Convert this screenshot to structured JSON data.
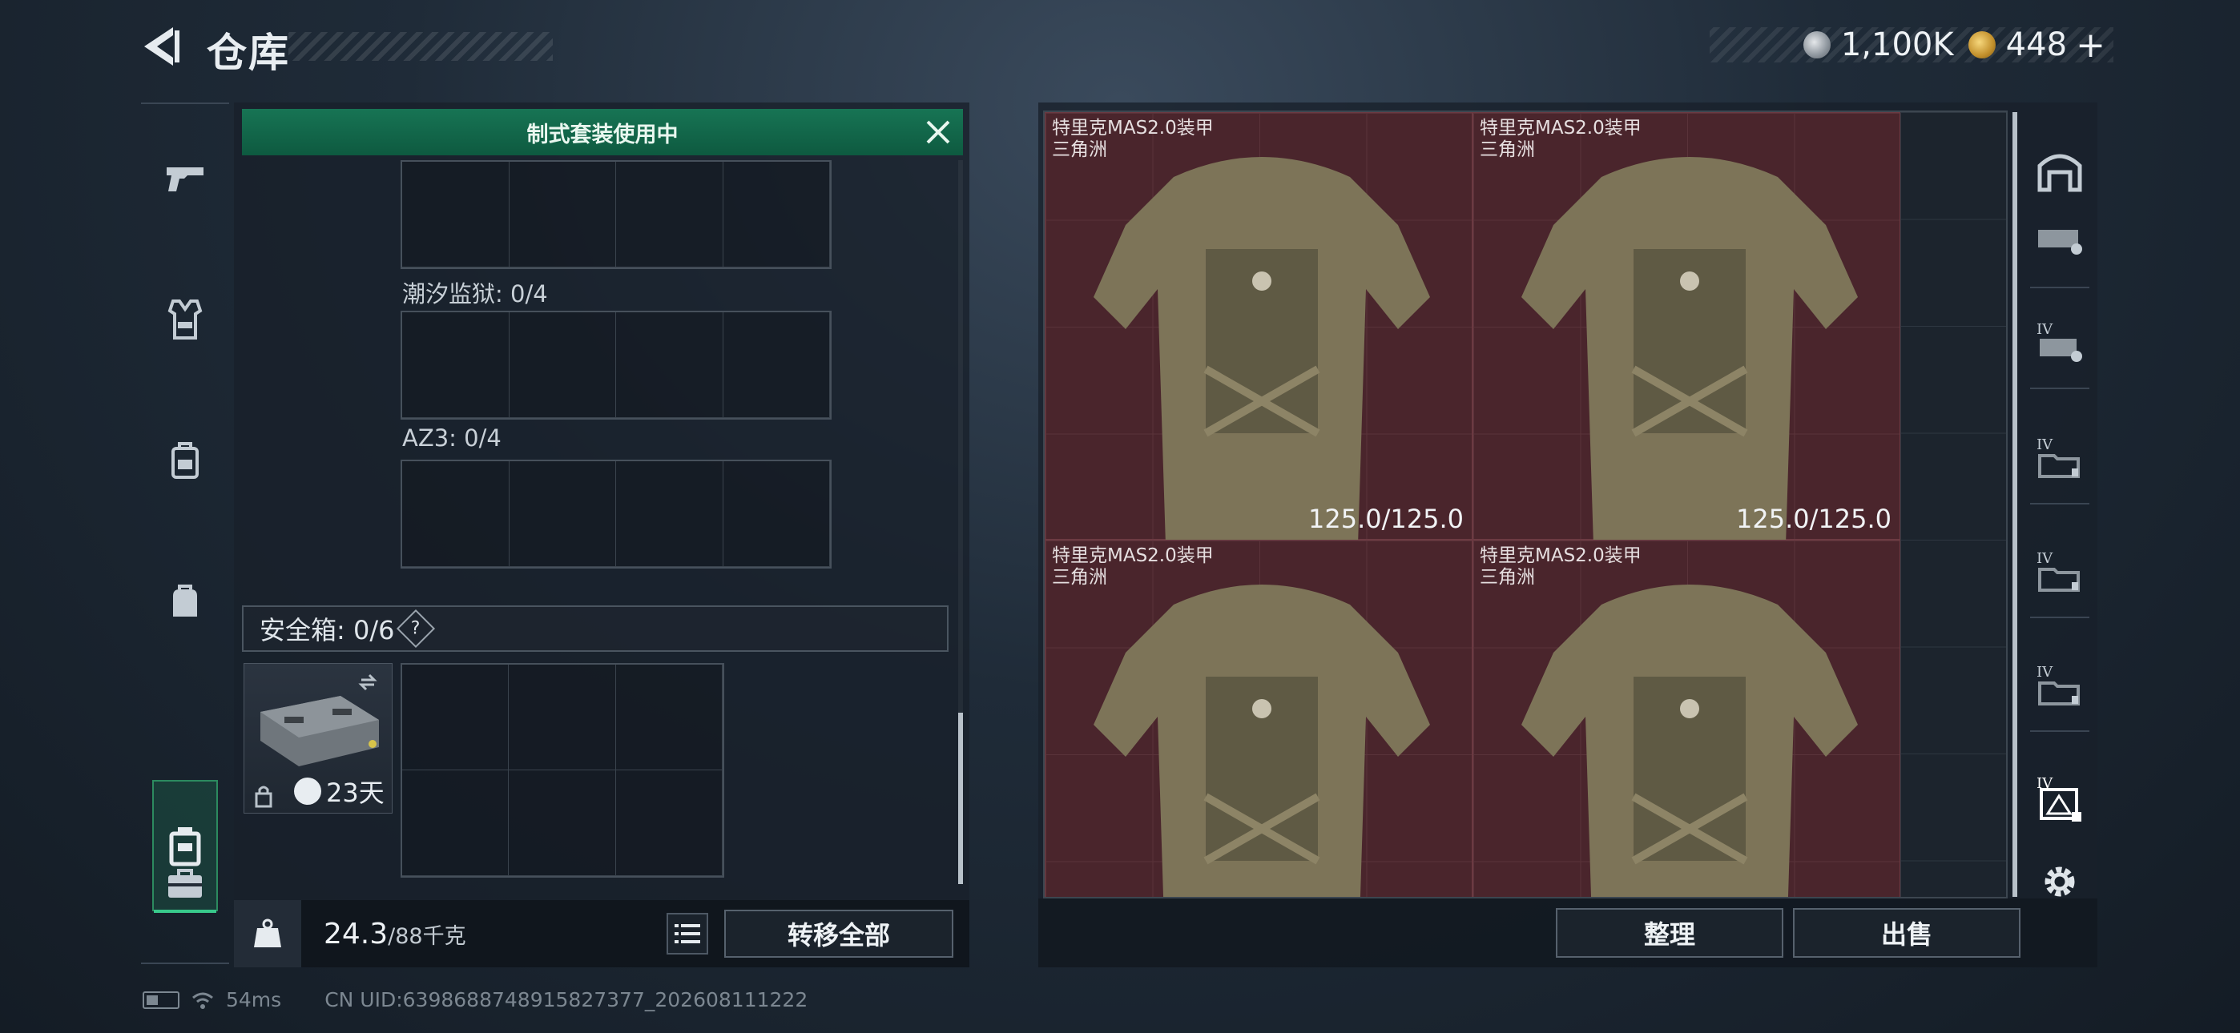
{
  "header": {
    "title": "仓库"
  },
  "currency": {
    "silver_value": "1,100K",
    "gold_value": "448",
    "add_label": "+",
    "silver_icon": "silver-coin-icon",
    "gold_icon": "gold-coin-icon"
  },
  "left_nav": {
    "items": [
      {
        "icon": "pistol-icon"
      },
      {
        "icon": "vest-icon"
      },
      {
        "icon": "backpack-icon"
      },
      {
        "icon": "bag-icon"
      },
      {
        "icon": "safebox-icon",
        "active": true
      },
      {
        "icon": "briefcase-icon"
      }
    ]
  },
  "loadout": {
    "banner": "制式套装使用中",
    "slots": [
      {
        "label": "潮汐监狱: 0/4"
      },
      {
        "label": "AZ3: 0/4"
      }
    ],
    "safebox_label": "安全箱: 0/6",
    "help_label": "?",
    "safebox_days": "23天",
    "weight_value": "24.3",
    "weight_max": "/88千克",
    "transfer_all": "转移全部"
  },
  "storage": {
    "items": [
      {
        "name": "特里克MAS2.0装甲",
        "sub": "三角洲",
        "durability": "125.0/125.0"
      },
      {
        "name": "特里克MAS2.0装甲",
        "sub": "三角洲",
        "durability": "125.0/125.0"
      },
      {
        "name": "特里克MAS2.0装甲",
        "sub": "三角洲",
        "durability": ""
      },
      {
        "name": "特里克MAS2.0装甲",
        "sub": "三角洲",
        "durability": ""
      }
    ],
    "item_bg_color": "#4a252c"
  },
  "right_nav": {
    "items": [
      {
        "icon": "storage-home-icon"
      },
      {
        "icon": "container-icon"
      },
      {
        "icon": "iv-container-icon",
        "tier": "IV"
      },
      {
        "icon": "iv-folder-icon",
        "tier": "IV"
      },
      {
        "icon": "iv-folder-icon",
        "tier": "IV"
      },
      {
        "icon": "iv-folder-icon",
        "tier": "IV"
      },
      {
        "icon": "iv-selected-icon",
        "tier": "IV"
      }
    ],
    "settings_icon": "gear-icon"
  },
  "actions": {
    "organize": "整理",
    "sell": "出售"
  },
  "status": {
    "ping": "54ms",
    "uid": "CN UID:6398688748915827377_202608111222"
  },
  "colors": {
    "accent_green": "#177454",
    "panel": "#18202a"
  }
}
